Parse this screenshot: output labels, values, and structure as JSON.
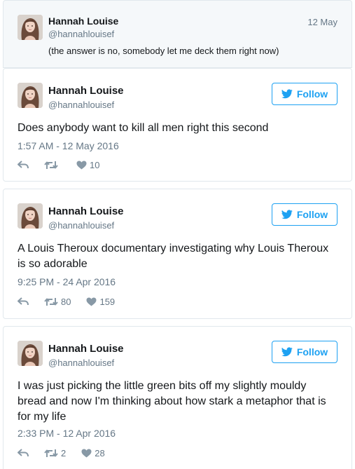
{
  "reply": {
    "name": "Hannah Louise",
    "handle": "@hannahlouisef",
    "date": "12 May",
    "text": "(the answer is no, somebody let me deck them right now)"
  },
  "tweets": [
    {
      "name": "Hannah Louise",
      "handle": "@hannahlouisef",
      "follow_label": "Follow",
      "text": "Does anybody want to kill all men right this second",
      "timestamp": "1:57 AM - 12 May 2016",
      "retweets": "",
      "likes": "10"
    },
    {
      "name": "Hannah Louise",
      "handle": "@hannahlouisef",
      "follow_label": "Follow",
      "text": "A Louis Theroux documentary investigating why Louis Theroux is so adorable",
      "timestamp": "9:25 PM - 24 Apr 2016",
      "retweets": "80",
      "likes": "159"
    },
    {
      "name": "Hannah Louise",
      "handle": "@hannahlouisef",
      "follow_label": "Follow",
      "text": "I was just picking the little green bits off my slightly mouldy bread and now I'm thinking about how stark a metaphor that is for my life",
      "timestamp": "2:33 PM - 12 Apr 2016",
      "retweets": "2",
      "likes": "28"
    }
  ],
  "icons": {
    "avatar": "avatar-photo",
    "follow": "twitter-bird-icon",
    "reply": "reply-icon",
    "retweet": "retweet-icon",
    "like": "heart-icon"
  },
  "colors": {
    "accent": "#1da1f2",
    "muted": "#657786",
    "border": "#e1e8ed"
  }
}
